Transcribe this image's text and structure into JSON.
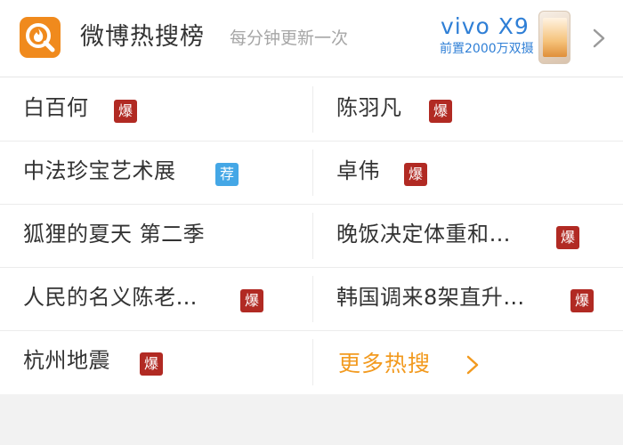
{
  "header": {
    "logo_icon": "hot-search-icon",
    "title": "微博热搜榜",
    "subtitle": "每分钟更新一次",
    "ad": {
      "brand": "vivo X9",
      "tagline": "前置2000万双摄"
    },
    "chevron_icon": "chevron-right-icon"
  },
  "colors": {
    "accent": "#f08a1d",
    "hot_badge": "#b12a23",
    "recommend_badge": "#44a7e6",
    "more_link": "#f29a1f",
    "ad_blue": "#2f7fd6"
  },
  "items": [
    {
      "text": "白百何",
      "badge": "爆"
    },
    {
      "text": "陈羽凡",
      "badge": "爆"
    },
    {
      "text": "中法珍宝艺术展",
      "badge": "荐"
    },
    {
      "text": "卓伟",
      "badge": "爆"
    },
    {
      "text": "狐狸的夏天 第二季",
      "badge": ""
    },
    {
      "text": "晚饭决定体重和…",
      "badge": "爆"
    },
    {
      "text": "人民的名义陈老…",
      "badge": "爆"
    },
    {
      "text": "韩国调来8架直升…",
      "badge": "爆"
    },
    {
      "text": "杭州地震",
      "badge": "爆"
    }
  ],
  "more": {
    "label": "更多热搜",
    "icon": "chevron-right-icon"
  }
}
